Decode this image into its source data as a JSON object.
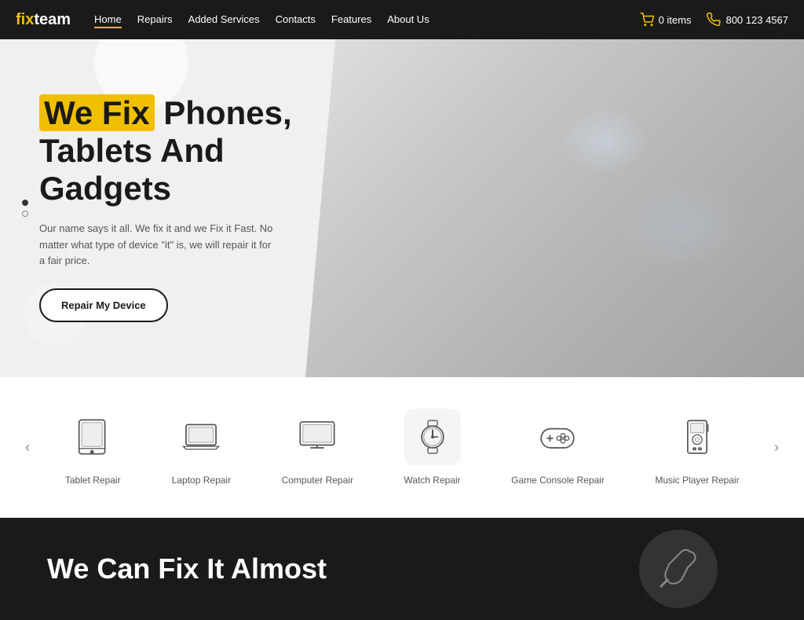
{
  "brand": {
    "name_prefix": "fix",
    "name_suffix": "team"
  },
  "navbar": {
    "links": [
      {
        "label": "Home",
        "active": true
      },
      {
        "label": "Repairs",
        "active": false
      },
      {
        "label": "Added Services",
        "active": false
      },
      {
        "label": "Contacts",
        "active": false
      },
      {
        "label": "Features",
        "active": false
      },
      {
        "label": "About Us",
        "active": false
      }
    ],
    "cart_label": "0 items",
    "phone": "800 123 4567"
  },
  "hero": {
    "title_prefix": "We Fix",
    "title_rest": " Phones,\nTablets And\nGadgets",
    "subtitle": "Our name says it all. We fix it and we Fix it Fast. No matter what type of device \"it\" is, we will repair it for a fair price.",
    "button_label": "Repair My Device"
  },
  "services": {
    "prev_arrow": "‹",
    "next_arrow": "›",
    "items": [
      {
        "label": "Tablet Repair",
        "icon": "tablet"
      },
      {
        "label": "Laptop Repair",
        "icon": "laptop"
      },
      {
        "label": "Computer Repair",
        "icon": "monitor"
      },
      {
        "label": "Watch Repair",
        "icon": "watch",
        "active": true
      },
      {
        "label": "Game Console Repair",
        "icon": "gamepad"
      },
      {
        "label": "Music Player Repair",
        "icon": "music-player"
      }
    ]
  },
  "bottom": {
    "title": "We Can Fix It Almost"
  }
}
